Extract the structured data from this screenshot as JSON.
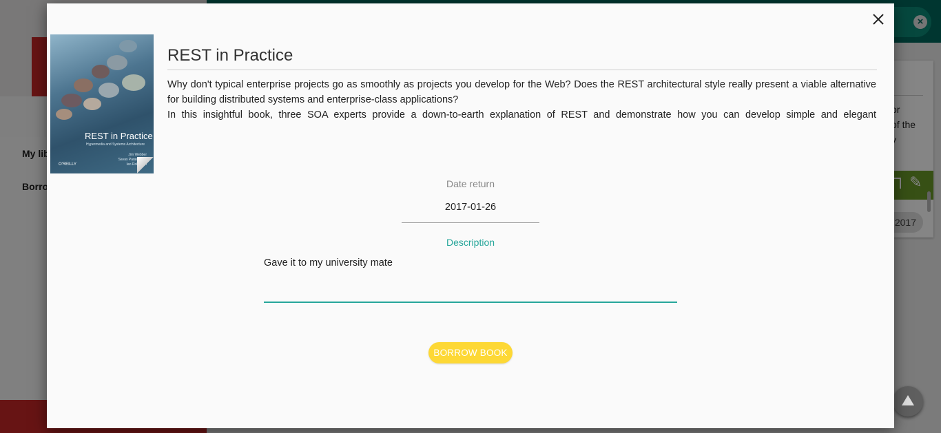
{
  "background": {
    "sidebar": {
      "items": [
        "My lib",
        "Borro"
      ]
    },
    "card": {
      "text": "or\nof the\ny",
      "date_chip": "2017"
    },
    "icons": {
      "search_clear": "close-circle-icon",
      "card_bookmark": "bookmark-icon",
      "card_edit": "pencil-icon",
      "scroll_top": "arrow-up-icon"
    }
  },
  "modal": {
    "close_icon": "close-icon",
    "cover": {
      "title": "REST in Practice",
      "subtitle": "Hypermedia and Systems Architecture",
      "authors": "Jim Webber\nSavas Parastatidis\nIan Robinson",
      "publisher": "O'REILLY"
    },
    "book": {
      "title": "REST in Practice",
      "description": [
        "Why don't typical enterprise projects go as smoothly as projects you develop for the Web? Does the REST architectural style really present a viable alternative for building distributed systems and enterprise-class applications?",
        "In this insightful book, three SOA experts provide a down-to-earth explanation of REST and demonstrate how you can develop simple and elegant"
      ]
    },
    "form": {
      "date_return_label": "Date return",
      "date_return_value": "2017-01-26",
      "description_label": "Description",
      "description_value": "Gave it to my university mate"
    },
    "actions": {
      "borrow_label": "BORROW BOOK"
    }
  },
  "colors": {
    "accent": "#26a69a",
    "primary": "#00695c",
    "button": "#fdd835",
    "sidebar_red": "#c62828"
  }
}
